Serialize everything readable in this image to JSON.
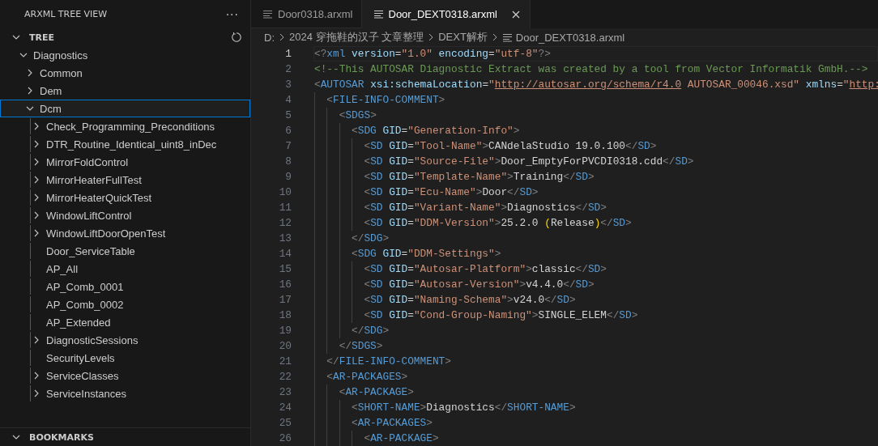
{
  "sidebar": {
    "title": "ARXML TREE VIEW",
    "more": "···",
    "sections": [
      {
        "title": "TREE",
        "expanded": true,
        "items": [
          {
            "label": "Diagnostics",
            "kind": "folder",
            "expanded": true,
            "focused": false,
            "children": [
              {
                "label": "Common",
                "kind": "folder",
                "expanded": false,
                "focused": false
              },
              {
                "label": "Dem",
                "kind": "folder",
                "expanded": false,
                "focused": false
              },
              {
                "label": "Dcm",
                "kind": "folder",
                "expanded": true,
                "focused": true,
                "children": [
                  {
                    "label": "Check_Programming_Preconditions",
                    "kind": "folder",
                    "expanded": false,
                    "focused": false
                  },
                  {
                    "label": "DTR_Routine_Identical_uint8_inDec",
                    "kind": "folder",
                    "expanded": false,
                    "focused": false
                  },
                  {
                    "label": "MirrorFoldControl",
                    "kind": "folder",
                    "expanded": false,
                    "focused": false
                  },
                  {
                    "label": "MirrorHeaterFullTest",
                    "kind": "folder",
                    "expanded": false,
                    "focused": false
                  },
                  {
                    "label": "MirrorHeaterQuickTest",
                    "kind": "folder",
                    "expanded": false,
                    "focused": false
                  },
                  {
                    "label": "WindowLiftControl",
                    "kind": "folder",
                    "expanded": false,
                    "focused": false
                  },
                  {
                    "label": "WindowLiftDoorOpenTest",
                    "kind": "folder",
                    "expanded": false,
                    "focused": false
                  },
                  {
                    "label": "Door_ServiceTable",
                    "kind": "leaf",
                    "focused": false
                  },
                  {
                    "label": "AP_All",
                    "kind": "leaf",
                    "focused": false
                  },
                  {
                    "label": "AP_Comb_0001",
                    "kind": "leaf",
                    "focused": false
                  },
                  {
                    "label": "AP_Comb_0002",
                    "kind": "leaf",
                    "focused": false
                  },
                  {
                    "label": "AP_Extended",
                    "kind": "leaf",
                    "focused": false
                  },
                  {
                    "label": "DiagnosticSessions",
                    "kind": "folder",
                    "expanded": false,
                    "focused": false
                  },
                  {
                    "label": "SecurityLevels",
                    "kind": "leaf",
                    "focused": false
                  },
                  {
                    "label": "ServiceClasses",
                    "kind": "folder",
                    "expanded": false,
                    "focused": false
                  },
                  {
                    "label": "ServiceInstances",
                    "kind": "folder",
                    "expanded": false,
                    "focused": false
                  }
                ]
              }
            ]
          }
        ]
      },
      {
        "title": "BOOKMARKS",
        "expanded": true
      }
    ]
  },
  "tabs": [
    {
      "label": "Door0318.arxml",
      "selected": false
    },
    {
      "label": "Door_DEXT0318.arxml",
      "selected": true
    }
  ],
  "breadcrumbs": [
    "D:",
    "2024 穿拖鞋的汉子 文章整理",
    "DEXT解析",
    "Door_DEXT0318.arxml"
  ],
  "lines": [
    {
      "number": "1",
      "current": true,
      "tokens": [
        {
          "kind": "punct",
          "text": "<?"
        },
        {
          "kind": "tag",
          "text": "xml"
        },
        {
          "kind": "attr",
          "text": " version"
        },
        {
          "kind": "op",
          "text": "="
        },
        {
          "kind": "string",
          "text": "\"1.0\""
        },
        {
          "kind": "attr",
          "text": " encoding"
        },
        {
          "kind": "op",
          "text": "="
        },
        {
          "kind": "string",
          "text": "\"utf-8\""
        },
        {
          "kind": "punct",
          "text": "?>"
        }
      ]
    },
    {
      "number": "2",
      "current": false,
      "tokens": [
        {
          "kind": "comment",
          "text": "<!--This AUTOSAR Diagnostic Extract was created by a tool from Vector Informatik GmbH.-->"
        }
      ]
    },
    {
      "number": "3",
      "current": false,
      "tokens": [
        {
          "kind": "punct",
          "text": "<"
        },
        {
          "kind": "tag",
          "text": "AUTOSAR"
        },
        {
          "kind": "attr",
          "text": " xsi:schemaLocation"
        },
        {
          "kind": "op",
          "text": "="
        },
        {
          "kind": "string",
          "text": "\""
        },
        {
          "kind": "link",
          "text": "http://autosar.org/schema/r4.0"
        },
        {
          "kind": "string",
          "text": " AUTOSAR_00046.xsd\""
        },
        {
          "kind": "attr",
          "text": " xmlns"
        },
        {
          "kind": "op",
          "text": "="
        },
        {
          "kind": "string",
          "text": "\""
        },
        {
          "kind": "link",
          "text": "http:"
        }
      ]
    },
    {
      "number": "4",
      "current": false,
      "tokens": [
        {
          "kind": "punct",
          "text": "  <"
        },
        {
          "kind": "tag",
          "text": "FILE-INFO-COMMENT"
        },
        {
          "kind": "punct",
          "text": ">"
        }
      ]
    },
    {
      "number": "5",
      "current": false,
      "tokens": [
        {
          "kind": "punct",
          "text": "    <"
        },
        {
          "kind": "tag",
          "text": "SDGS"
        },
        {
          "kind": "punct",
          "text": ">"
        }
      ]
    },
    {
      "number": "6",
      "current": false,
      "tokens": [
        {
          "kind": "punct",
          "text": "      <"
        },
        {
          "kind": "tag",
          "text": "SDG"
        },
        {
          "kind": "attr",
          "text": " GID"
        },
        {
          "kind": "op",
          "text": "="
        },
        {
          "kind": "string",
          "text": "\"Generation-Info\""
        },
        {
          "kind": "punct",
          "text": ">"
        }
      ]
    },
    {
      "number": "7",
      "current": false,
      "tokens": [
        {
          "kind": "punct",
          "text": "        <"
        },
        {
          "kind": "tag",
          "text": "SD"
        },
        {
          "kind": "attr",
          "text": " GID"
        },
        {
          "kind": "op",
          "text": "="
        },
        {
          "kind": "string",
          "text": "\"Tool-Name\""
        },
        {
          "kind": "punct",
          "text": ">"
        },
        {
          "kind": "text",
          "text": "CANdelaStudio 19.0.100"
        },
        {
          "kind": "punct",
          "text": "</"
        },
        {
          "kind": "tag",
          "text": "SD"
        },
        {
          "kind": "punct",
          "text": ">"
        }
      ]
    },
    {
      "number": "8",
      "current": false,
      "tokens": [
        {
          "kind": "punct",
          "text": "        <"
        },
        {
          "kind": "tag",
          "text": "SD"
        },
        {
          "kind": "attr",
          "text": " GID"
        },
        {
          "kind": "op",
          "text": "="
        },
        {
          "kind": "string",
          "text": "\"Source-File\""
        },
        {
          "kind": "punct",
          "text": ">"
        },
        {
          "kind": "text",
          "text": "Door_EmptyForPVCDI0318.cdd"
        },
        {
          "kind": "punct",
          "text": "</"
        },
        {
          "kind": "tag",
          "text": "SD"
        },
        {
          "kind": "punct",
          "text": ">"
        }
      ]
    },
    {
      "number": "9",
      "current": false,
      "tokens": [
        {
          "kind": "punct",
          "text": "        <"
        },
        {
          "kind": "tag",
          "text": "SD"
        },
        {
          "kind": "attr",
          "text": " GID"
        },
        {
          "kind": "op",
          "text": "="
        },
        {
          "kind": "string",
          "text": "\"Template-Name\""
        },
        {
          "kind": "punct",
          "text": ">"
        },
        {
          "kind": "text",
          "text": "Training"
        },
        {
          "kind": "punct",
          "text": "</"
        },
        {
          "kind": "tag",
          "text": "SD"
        },
        {
          "kind": "punct",
          "text": ">"
        }
      ]
    },
    {
      "number": "10",
      "current": false,
      "tokens": [
        {
          "kind": "punct",
          "text": "        <"
        },
        {
          "kind": "tag",
          "text": "SD"
        },
        {
          "kind": "attr",
          "text": " GID"
        },
        {
          "kind": "op",
          "text": "="
        },
        {
          "kind": "string",
          "text": "\"Ecu-Name\""
        },
        {
          "kind": "punct",
          "text": ">"
        },
        {
          "kind": "text",
          "text": "Door"
        },
        {
          "kind": "punct",
          "text": "</"
        },
        {
          "kind": "tag",
          "text": "SD"
        },
        {
          "kind": "punct",
          "text": ">"
        }
      ]
    },
    {
      "number": "11",
      "current": false,
      "tokens": [
        {
          "kind": "punct",
          "text": "        <"
        },
        {
          "kind": "tag",
          "text": "SD"
        },
        {
          "kind": "attr",
          "text": " GID"
        },
        {
          "kind": "op",
          "text": "="
        },
        {
          "kind": "string",
          "text": "\"Variant-Name\""
        },
        {
          "kind": "punct",
          "text": ">"
        },
        {
          "kind": "text",
          "text": "Diagnostics"
        },
        {
          "kind": "punct",
          "text": "</"
        },
        {
          "kind": "tag",
          "text": "SD"
        },
        {
          "kind": "punct",
          "text": ">"
        }
      ]
    },
    {
      "number": "12",
      "current": false,
      "tokens": [
        {
          "kind": "punct",
          "text": "        <"
        },
        {
          "kind": "tag",
          "text": "SD"
        },
        {
          "kind": "attr",
          "text": " GID"
        },
        {
          "kind": "op",
          "text": "="
        },
        {
          "kind": "string",
          "text": "\"DDM-Version\""
        },
        {
          "kind": "punct",
          "text": ">"
        },
        {
          "kind": "text",
          "text": "25.2.0 "
        },
        {
          "kind": "bracket",
          "text": "("
        },
        {
          "kind": "text",
          "text": "Release"
        },
        {
          "kind": "bracket",
          "text": ")"
        },
        {
          "kind": "punct",
          "text": "</"
        },
        {
          "kind": "tag",
          "text": "SD"
        },
        {
          "kind": "punct",
          "text": ">"
        }
      ]
    },
    {
      "number": "13",
      "current": false,
      "tokens": [
        {
          "kind": "punct",
          "text": "      </"
        },
        {
          "kind": "tag",
          "text": "SDG"
        },
        {
          "kind": "punct",
          "text": ">"
        }
      ]
    },
    {
      "number": "14",
      "current": false,
      "tokens": [
        {
          "kind": "punct",
          "text": "      <"
        },
        {
          "kind": "tag",
          "text": "SDG"
        },
        {
          "kind": "attr",
          "text": " GID"
        },
        {
          "kind": "op",
          "text": "="
        },
        {
          "kind": "string",
          "text": "\"DDM-Settings\""
        },
        {
          "kind": "punct",
          "text": ">"
        }
      ]
    },
    {
      "number": "15",
      "current": false,
      "tokens": [
        {
          "kind": "punct",
          "text": "        <"
        },
        {
          "kind": "tag",
          "text": "SD"
        },
        {
          "kind": "attr",
          "text": " GID"
        },
        {
          "kind": "op",
          "text": "="
        },
        {
          "kind": "string",
          "text": "\"Autosar-Platform\""
        },
        {
          "kind": "punct",
          "text": ">"
        },
        {
          "kind": "text",
          "text": "classic"
        },
        {
          "kind": "punct",
          "text": "</"
        },
        {
          "kind": "tag",
          "text": "SD"
        },
        {
          "kind": "punct",
          "text": ">"
        }
      ]
    },
    {
      "number": "16",
      "current": false,
      "tokens": [
        {
          "kind": "punct",
          "text": "        <"
        },
        {
          "kind": "tag",
          "text": "SD"
        },
        {
          "kind": "attr",
          "text": " GID"
        },
        {
          "kind": "op",
          "text": "="
        },
        {
          "kind": "string",
          "text": "\"Autosar-Version\""
        },
        {
          "kind": "punct",
          "text": ">"
        },
        {
          "kind": "text",
          "text": "v4.4.0"
        },
        {
          "kind": "punct",
          "text": "</"
        },
        {
          "kind": "tag",
          "text": "SD"
        },
        {
          "kind": "punct",
          "text": ">"
        }
      ]
    },
    {
      "number": "17",
      "current": false,
      "tokens": [
        {
          "kind": "punct",
          "text": "        <"
        },
        {
          "kind": "tag",
          "text": "SD"
        },
        {
          "kind": "attr",
          "text": " GID"
        },
        {
          "kind": "op",
          "text": "="
        },
        {
          "kind": "string",
          "text": "\"Naming-Schema\""
        },
        {
          "kind": "punct",
          "text": ">"
        },
        {
          "kind": "text",
          "text": "v24.0"
        },
        {
          "kind": "punct",
          "text": "</"
        },
        {
          "kind": "tag",
          "text": "SD"
        },
        {
          "kind": "punct",
          "text": ">"
        }
      ]
    },
    {
      "number": "18",
      "current": false,
      "tokens": [
        {
          "kind": "punct",
          "text": "        <"
        },
        {
          "kind": "tag",
          "text": "SD"
        },
        {
          "kind": "attr",
          "text": " GID"
        },
        {
          "kind": "op",
          "text": "="
        },
        {
          "kind": "string",
          "text": "\"Cond-Group-Naming\""
        },
        {
          "kind": "punct",
          "text": ">"
        },
        {
          "kind": "text",
          "text": "SINGLE_ELEM"
        },
        {
          "kind": "punct",
          "text": "</"
        },
        {
          "kind": "tag",
          "text": "SD"
        },
        {
          "kind": "punct",
          "text": ">"
        }
      ]
    },
    {
      "number": "19",
      "current": false,
      "tokens": [
        {
          "kind": "punct",
          "text": "      </"
        },
        {
          "kind": "tag",
          "text": "SDG"
        },
        {
          "kind": "punct",
          "text": ">"
        }
      ]
    },
    {
      "number": "20",
      "current": false,
      "tokens": [
        {
          "kind": "punct",
          "text": "    </"
        },
        {
          "kind": "tag",
          "text": "SDGS"
        },
        {
          "kind": "punct",
          "text": ">"
        }
      ]
    },
    {
      "number": "21",
      "current": false,
      "tokens": [
        {
          "kind": "punct",
          "text": "  </"
        },
        {
          "kind": "tag",
          "text": "FILE-INFO-COMMENT"
        },
        {
          "kind": "punct",
          "text": ">"
        }
      ]
    },
    {
      "number": "22",
      "current": false,
      "tokens": [
        {
          "kind": "punct",
          "text": "  <"
        },
        {
          "kind": "tag",
          "text": "AR-PACKAGES"
        },
        {
          "kind": "punct",
          "text": ">"
        }
      ]
    },
    {
      "number": "23",
      "current": false,
      "tokens": [
        {
          "kind": "punct",
          "text": "    <"
        },
        {
          "kind": "tag",
          "text": "AR-PACKAGE"
        },
        {
          "kind": "punct",
          "text": ">"
        }
      ]
    },
    {
      "number": "24",
      "current": false,
      "tokens": [
        {
          "kind": "punct",
          "text": "      <"
        },
        {
          "kind": "tag",
          "text": "SHORT-NAME"
        },
        {
          "kind": "punct",
          "text": ">"
        },
        {
          "kind": "text",
          "text": "Diagnostics"
        },
        {
          "kind": "punct",
          "text": "</"
        },
        {
          "kind": "tag",
          "text": "SHORT-NAME"
        },
        {
          "kind": "punct",
          "text": ">"
        }
      ]
    },
    {
      "number": "25",
      "current": false,
      "tokens": [
        {
          "kind": "punct",
          "text": "      <"
        },
        {
          "kind": "tag",
          "text": "AR-PACKAGES"
        },
        {
          "kind": "punct",
          "text": ">"
        }
      ]
    },
    {
      "number": "26",
      "current": false,
      "tokens": [
        {
          "kind": "punct",
          "text": "        <"
        },
        {
          "kind": "tag",
          "text": "AR-PACKAGE"
        },
        {
          "kind": "punct",
          "text": ">"
        }
      ]
    }
  ]
}
